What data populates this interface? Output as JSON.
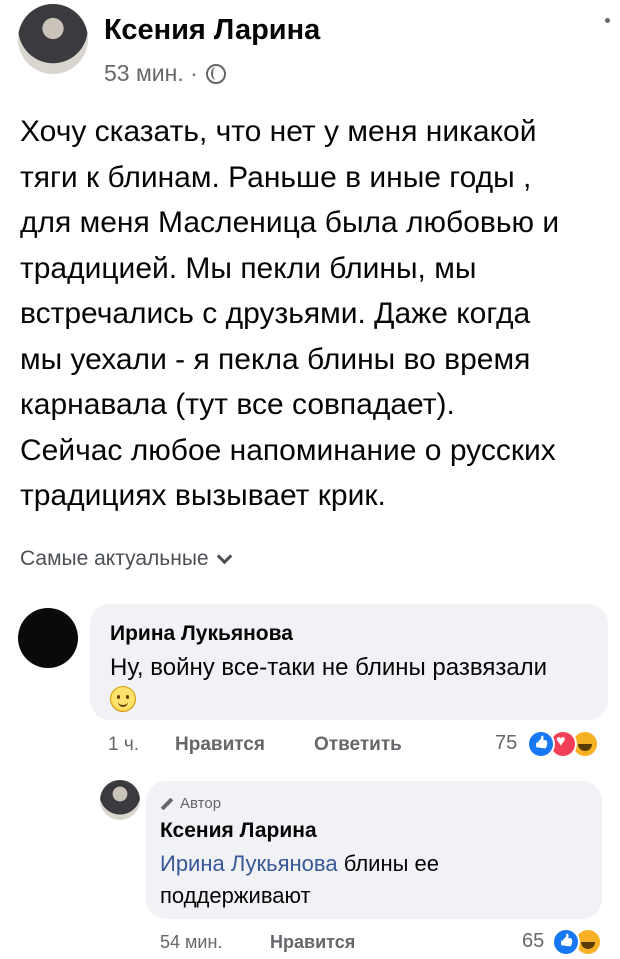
{
  "post": {
    "author": "Ксения Ларина",
    "time": "53 мин. ·",
    "text": "Хочу сказать, что нет у меня никакой\nтяги к блинам. Раньше в иные годы ,\nдля меня Масленица была любовью и\nтрадицией.  Мы пекли блины, мы\nвстречались с друзьями. Даже когда\nмы уехали - я пекла блины во время\nкарнавала (тут все совпадает).\nСейчас любое напоминание о русских\nтрадициях вызывает крик."
  },
  "comments_sort": "Самые актуальные",
  "comment1": {
    "author": "Ирина Лукьянова",
    "text": "Ну, войну все-таки не блины развязали",
    "time": "1 ч.",
    "like": "Нравится",
    "reply": "Ответить",
    "reactions": "75",
    "reaction_icons": [
      "like-icon",
      "love-icon",
      "haha-icon"
    ]
  },
  "reply1": {
    "badge": "Автор",
    "author": "Ксения Ларина",
    "mention": "Ирина Лукьянова",
    "text": " блины ее поддерживают",
    "time": "54 мин.",
    "like": "Нравится",
    "reactions": "65",
    "reaction_icons": [
      "like-icon",
      "haha-icon"
    ]
  },
  "colors": {
    "accent": "#1877f2",
    "mention": "#385898",
    "bubble": "#f0f2f5",
    "secondary_text": "#65676b"
  }
}
